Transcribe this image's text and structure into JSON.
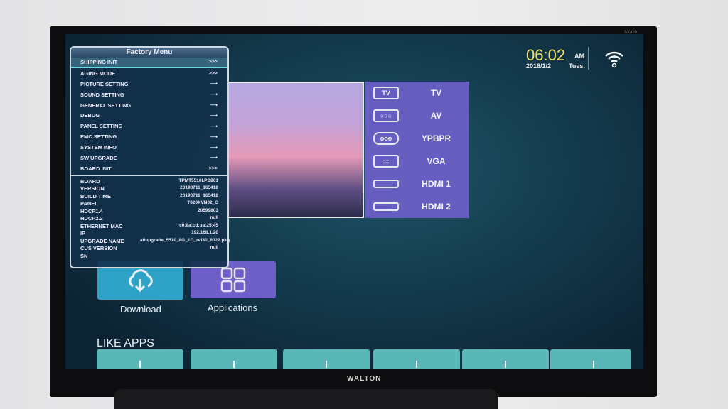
{
  "tv": {
    "brand": "WALTON",
    "model_label": "SV320"
  },
  "status": {
    "time": "06:02",
    "ampm": "AM",
    "date": "2018/1/2",
    "day": "Tues.",
    "wifi_icon": "wifi-icon"
  },
  "sources": [
    {
      "icon": "TV",
      "label": "TV"
    },
    {
      "icon": "av-icon",
      "label": "AV"
    },
    {
      "icon": "ypbpr-icon",
      "label": "YPBPR"
    },
    {
      "icon": "vga-icon",
      "label": "VGA"
    },
    {
      "icon": "hdmi-icon",
      "label": "HDMI 1"
    },
    {
      "icon": "hdmi-icon",
      "label": "HDMI 2"
    }
  ],
  "tiles": {
    "download": "Download",
    "applications": "Applications"
  },
  "like_apps": "LIKE APPS",
  "factory_menu": {
    "title": "Factory Menu",
    "items": [
      {
        "label": "SHIPPING INIT",
        "arrow": ">>>"
      },
      {
        "label": "AGING MODE",
        "arrow": ">>>"
      },
      {
        "label": "PICTURE SETTING",
        "arrow": "⟶"
      },
      {
        "label": "SOUND SETTING",
        "arrow": "⟶"
      },
      {
        "label": "GENERAL SETTING",
        "arrow": "⟶"
      },
      {
        "label": "DEBUG",
        "arrow": "⟶"
      },
      {
        "label": "PANEL SETTING",
        "arrow": "⟶"
      },
      {
        "label": "EMC SETTING",
        "arrow": "⟶"
      },
      {
        "label": "SYSTEM INFO",
        "arrow": "⟶"
      },
      {
        "label": "SW UPGRADE",
        "arrow": "⟶"
      },
      {
        "label": "BOARD INIT",
        "arrow": ">>>"
      }
    ],
    "info": [
      {
        "key": "BOARD",
        "value": "TPMT5510I.PB801"
      },
      {
        "key": "VERSION",
        "value": "20190711_165418"
      },
      {
        "key": "BUILD TIME",
        "value": "20190711_165418"
      },
      {
        "key": "PANEL",
        "value": "T320XVN02_C"
      },
      {
        "key": "HDCP1.4",
        "value": "20599803"
      },
      {
        "key": "HDCP2.2",
        "value": "null"
      },
      {
        "key": "ETHERNET MAC",
        "value": "c0:8a:cd:ba:25:45"
      },
      {
        "key": "IP",
        "value": "192.168.1.20"
      },
      {
        "key": "UPGRADE NAME",
        "value": "allupgrade_5510_8G_1G_ref30_6022.pkg"
      },
      {
        "key": "CUS VERSION",
        "value": "null"
      },
      {
        "key": "SN",
        "value": ""
      }
    ]
  }
}
